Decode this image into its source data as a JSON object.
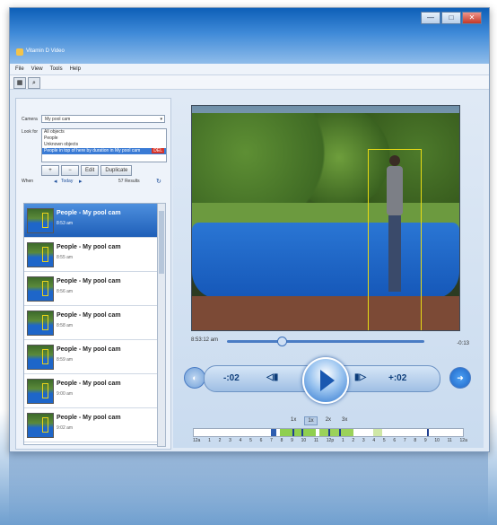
{
  "app": {
    "title": "Vitamin D Video"
  },
  "window_controls": [
    "—",
    "□",
    "✕"
  ],
  "menu": [
    "File",
    "View",
    "Tools",
    "Help"
  ],
  "toolbar": {
    "icons": [
      "layout-icon",
      "search-icon"
    ]
  },
  "search": {
    "camera_label": "Camera",
    "camera_value": "My pool cam",
    "look_label": "Look for",
    "look_items": [
      {
        "label": "All objects"
      },
      {
        "label": "People"
      },
      {
        "label": "Unknown objects"
      },
      {
        "label": "People in top of here by duration in My pool cam"
      }
    ],
    "selected_look_index": 3,
    "buttons": {
      "add": "+",
      "remove": "−",
      "edit": "Edit",
      "duplicate": "Duplicate"
    },
    "filter_label": "When",
    "filter_value": "Today",
    "results_count": "57 Results"
  },
  "results": [
    {
      "title": "People - My pool cam",
      "time": "8:53 am"
    },
    {
      "title": "People - My pool cam",
      "time": "8:55 am"
    },
    {
      "title": "People - My pool cam",
      "time": "8:56 am"
    },
    {
      "title": "People - My pool cam",
      "time": "8:58 am"
    },
    {
      "title": "People - My pool cam",
      "time": "8:59 am"
    },
    {
      "title": "People - My pool cam",
      "time": "9:00 am"
    },
    {
      "title": "People - My pool cam",
      "time": "9:02 am"
    }
  ],
  "player": {
    "current_time": "8:53:12 am",
    "remaining": "-0:13",
    "back_label": "-:02",
    "forward_label": "+:02",
    "speeds": [
      "1x",
      "1x",
      "2x",
      "3x"
    ],
    "selected_speed_index": 1,
    "seek_position_percent": 25
  },
  "timeline": {
    "labels": [
      "12a",
      "1",
      "2",
      "3",
      "4",
      "5",
      "6",
      "7",
      "8",
      "9",
      "10",
      "11",
      "12p",
      "1",
      "2",
      "3",
      "4",
      "5",
      "6",
      "7",
      "8",
      "9",
      "10",
      "11",
      "12a"
    ]
  }
}
